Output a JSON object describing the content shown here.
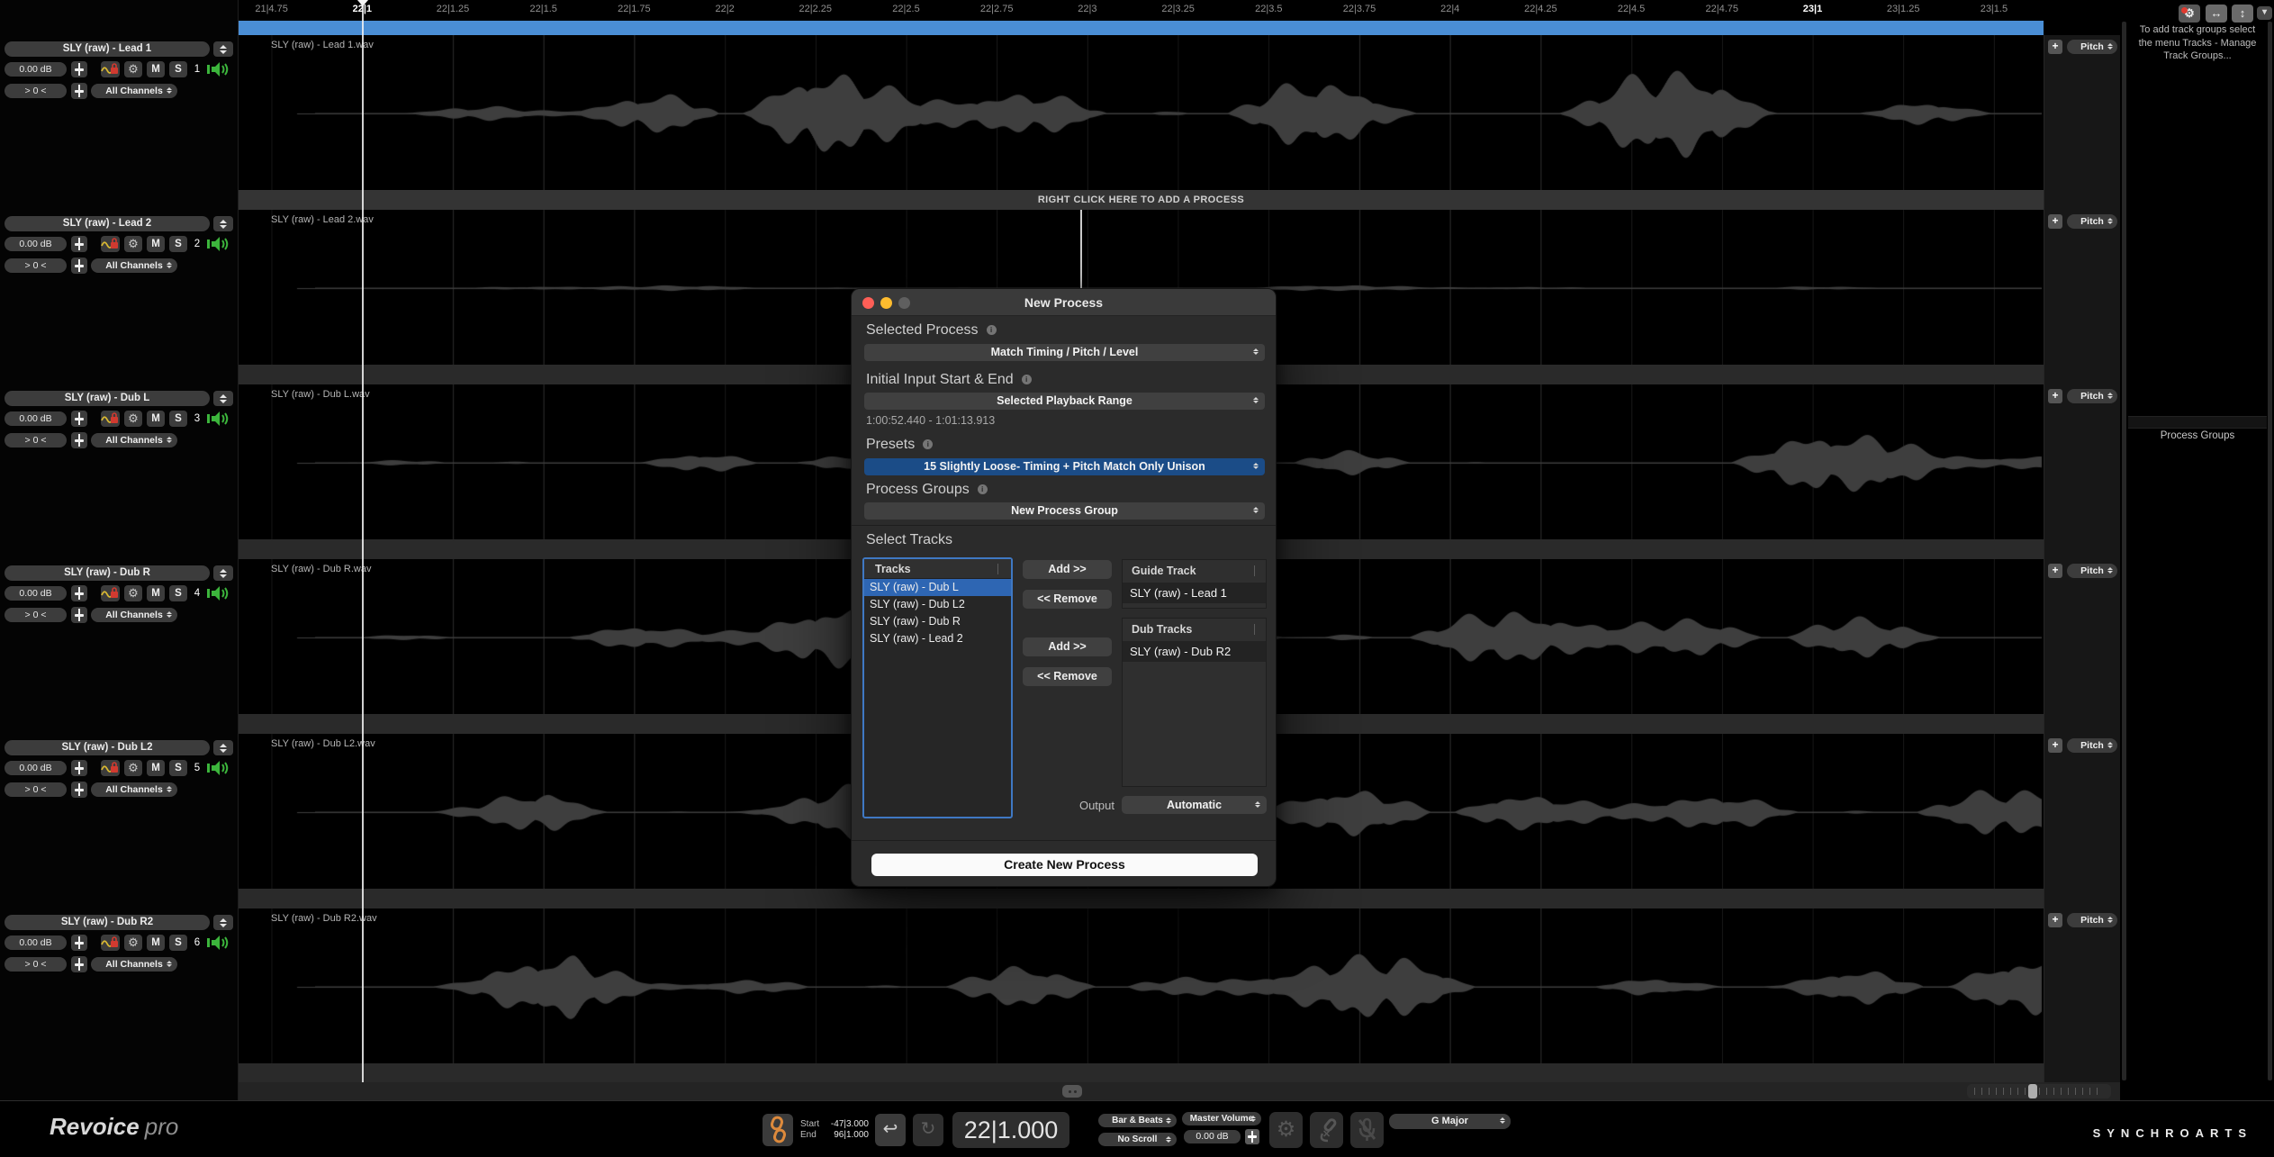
{
  "branding": {
    "revoice": "Revoice",
    "pro": "pro",
    "synchro": "SYNCHROARTS"
  },
  "colors": {
    "selection_blue": "#4a8ed5",
    "preset_blue": "#1b4c87",
    "list_selection_blue": "#2e66b3",
    "focus_ring_blue": "#3f78c3",
    "speaker_green": "#3cb53c",
    "link_orange": "#dd8a3c",
    "lock_red": "#d03a30",
    "wave_yellow": "#d8b832",
    "traffic_red": "#ff5f57",
    "traffic_yellow": "#febc2e"
  },
  "icons": {
    "gear": "⚙",
    "undo": "↩",
    "loop": "↻",
    "chevron_down": "▾",
    "plus": "+",
    "info": "i",
    "h_arrows": "↔",
    "v_arrows": "↕",
    "cross": "✕"
  },
  "ruler": {
    "labels": [
      {
        "text": "21|4.75",
        "bar": false
      },
      {
        "text": "22|1",
        "bar": true
      },
      {
        "text": "22|1.25",
        "bar": false
      },
      {
        "text": "22|1.5",
        "bar": false
      },
      {
        "text": "22|1.75",
        "bar": false
      },
      {
        "text": "22|2",
        "bar": false
      },
      {
        "text": "22|2.25",
        "bar": false
      },
      {
        "text": "22|2.5",
        "bar": false
      },
      {
        "text": "22|2.75",
        "bar": false
      },
      {
        "text": "22|3",
        "bar": false
      },
      {
        "text": "22|3.25",
        "bar": false
      },
      {
        "text": "22|3.5",
        "bar": false
      },
      {
        "text": "22|3.75",
        "bar": false
      },
      {
        "text": "22|4",
        "bar": false
      },
      {
        "text": "22|4.25",
        "bar": false
      },
      {
        "text": "22|4.5",
        "bar": false
      },
      {
        "text": "22|4.75",
        "bar": false
      },
      {
        "text": "23|1",
        "bar": true
      },
      {
        "text": "23|1.25",
        "bar": false
      },
      {
        "text": "23|1.5",
        "bar": false
      }
    ]
  },
  "track_controls": {
    "mute_label": "M",
    "solo_label": "S"
  },
  "tracks_area": {
    "add_process_hint": "RIGHT CLICK HERE TO ADD A PROCESS"
  },
  "tracks": [
    {
      "name": "SLY (raw) - Lead 1",
      "file": "SLY (raw) - Lead 1.wav",
      "number": "1",
      "gain": "0.00 dB",
      "threshold": "> 0 <",
      "channels": "All Channels",
      "pitch": "Pitch",
      "wave": {
        "seed": 11,
        "amp": 45
      }
    },
    {
      "name": "SLY (raw) - Lead 2",
      "file": "SLY (raw) - Lead 2.wav",
      "number": "2",
      "gain": "0.00 dB",
      "threshold": "> 0 <",
      "channels": "All Channels",
      "pitch": "Pitch",
      "wave": {
        "seed": 22,
        "amp": 3
      }
    },
    {
      "name": "SLY (raw) - Dub L",
      "file": "SLY (raw) - Dub L.wav",
      "number": "3",
      "gain": "0.00 dB",
      "threshold": "> 0 <",
      "channels": "All Channels",
      "pitch": "Pitch",
      "wave": {
        "seed": 33,
        "amp": 30
      }
    },
    {
      "name": "SLY (raw) - Dub R",
      "file": "SLY (raw) - Dub R.wav",
      "number": "4",
      "gain": "0.00 dB",
      "threshold": "> 0 <",
      "channels": "All Channels",
      "pitch": "Pitch",
      "wave": {
        "seed": 44,
        "amp": 32
      }
    },
    {
      "name": "SLY (raw) - Dub L2",
      "file": "SLY (raw) - Dub L2.wav",
      "number": "5",
      "gain": "0.00 dB",
      "threshold": "> 0 <",
      "channels": "All Channels",
      "pitch": "Pitch",
      "wave": {
        "seed": 55,
        "amp": 30
      }
    },
    {
      "name": "SLY (raw) - Dub R2",
      "file": "SLY (raw) - Dub R2.wav",
      "number": "6",
      "gain": "0.00 dB",
      "threshold": "> 0 <",
      "channels": "All Channels",
      "pitch": "Pitch",
      "wave": {
        "seed": 66,
        "amp": 33
      }
    }
  ],
  "dialog": {
    "title": "New Process",
    "selected_process_label": "Selected Process",
    "selected_process_value": "Match Timing / Pitch / Level",
    "initial_input_label": "Initial Input Start & End",
    "initial_input_value": "Selected Playback Range",
    "time_range": "1:00:52.440 - 1:01:13.913",
    "presets_label": "Presets",
    "presets_value": "15 Slightly Loose- Timing + Pitch Match Only Unison",
    "process_groups_label": "Process Groups",
    "process_groups_value": "New Process Group",
    "select_tracks_label": "Select Tracks",
    "tracks_header": "Tracks",
    "track_items": [
      "SLY (raw) - Dub L",
      "SLY (raw) - Dub L2",
      "SLY (raw) - Dub R",
      "SLY (raw) - Lead 2"
    ],
    "selected_item": "SLY (raw) - Dub L",
    "add_button": "Add >>",
    "remove_button": "<< Remove",
    "guide_track_header": "Guide Track",
    "guide_track_item": "SLY (raw) - Lead 1",
    "dub_tracks_header": "Dub Tracks",
    "dub_tracks_item": "SLY (raw) - Dub R2",
    "output_label": "Output",
    "output_value": "Automatic",
    "create_button": "Create New Process"
  },
  "sidebar": {
    "hint": "To add track groups select the menu Tracks - Manage Track Groups...",
    "process_groups_title": "Process Groups"
  },
  "transport": {
    "start_label": "Start",
    "start_value": "-47|3.000",
    "end_label": "End",
    "end_value": "96|1.000",
    "time_display": "22|1.000",
    "bar_beats_value": "Bar & Beats",
    "scroll_value": "No Scroll",
    "master_volume_label": "Master Volume",
    "master_volume_value": "0.00 dB",
    "key_value": "G Major"
  }
}
